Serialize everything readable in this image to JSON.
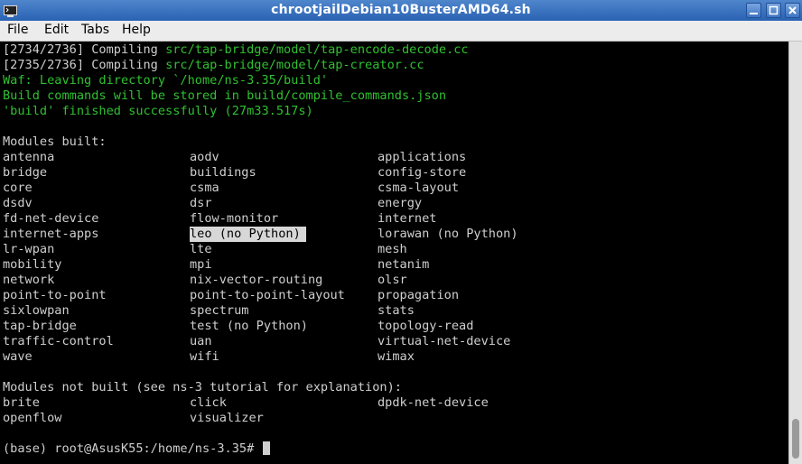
{
  "window": {
    "title": "chrootjailDebian10BusterAMD64.sh"
  },
  "menu": [
    "File",
    "Edit",
    "Tabs",
    "Help"
  ],
  "terminal": {
    "build_log": [
      {
        "prefix": "[2734/2736] Compiling ",
        "path": "src/tap-bridge/model/tap-encode-decode.cc"
      },
      {
        "prefix": "[2735/2736] Compiling ",
        "path": "src/tap-bridge/model/tap-creator.cc"
      }
    ],
    "waf_lines": [
      "Waf: Leaving directory `/home/ns-3.35/build'",
      "Build commands will be stored in build/compile_commands.json",
      "'build' finished successfully (27m33.517s)"
    ],
    "modules_built_header": "Modules built:",
    "modules_built": [
      [
        "antenna",
        "aodv",
        "applications"
      ],
      [
        "bridge",
        "buildings",
        "config-store"
      ],
      [
        "core",
        "csma",
        "csma-layout"
      ],
      [
        "dsdv",
        "dsr",
        "energy"
      ],
      [
        "fd-net-device",
        "flow-monitor",
        "internet"
      ],
      [
        "internet-apps",
        "leo (no Python)",
        "lorawan (no Python)"
      ],
      [
        "lr-wpan",
        "lte",
        "mesh"
      ],
      [
        "mobility",
        "mpi",
        "netanim"
      ],
      [
        "network",
        "nix-vector-routing",
        "olsr"
      ],
      [
        "point-to-point",
        "point-to-point-layout",
        "propagation"
      ],
      [
        "sixlowpan",
        "spectrum",
        "stats"
      ],
      [
        "tap-bridge",
        "test (no Python)",
        "topology-read"
      ],
      [
        "traffic-control",
        "uan",
        "virtual-net-device"
      ],
      [
        "wave",
        "wifi",
        "wimax"
      ]
    ],
    "highlighted_module": "leo (no Python)",
    "modules_not_built_header": "Modules not built (see ns-3 tutorial for explanation):",
    "modules_not_built": [
      [
        "brite",
        "click",
        "dpdk-net-device"
      ],
      [
        "openflow",
        "visualizer",
        ""
      ]
    ],
    "prompt": "(base) root@AsusK55:/home/ns-3.35# "
  },
  "colors": {
    "title_bar": "#2a62b3",
    "terminal_bg": "#000000",
    "terminal_fg": "#cfcfcf",
    "terminal_green": "#30c030",
    "highlight_bg": "#d7d7d7"
  },
  "icons": {
    "app": "terminal-icon",
    "minimize": "minimize-icon",
    "maximize": "maximize-icon",
    "close": "close-icon"
  }
}
